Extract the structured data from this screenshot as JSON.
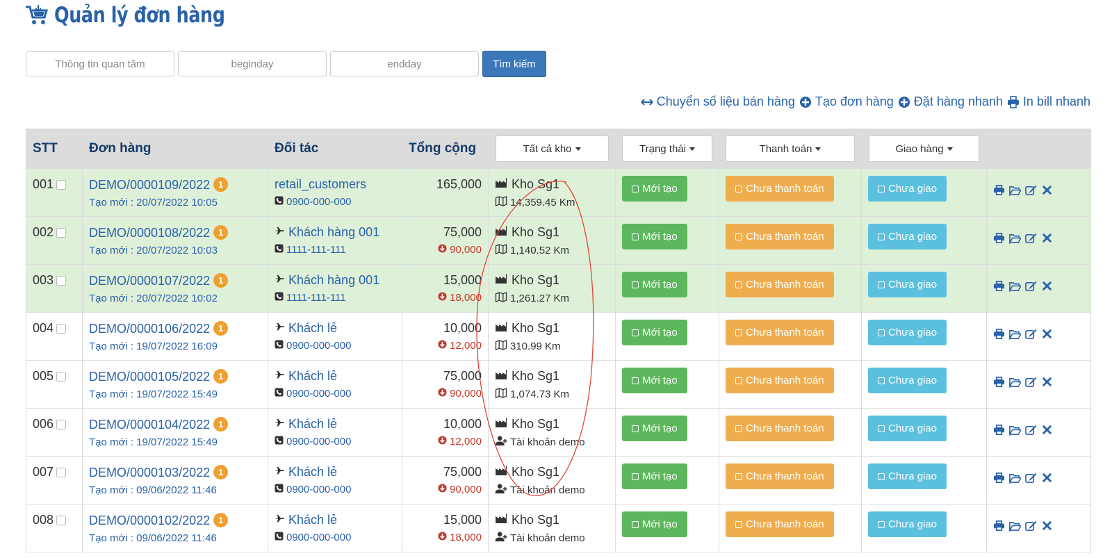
{
  "page": {
    "title": "Quản lý đơn hàng"
  },
  "search": {
    "interest_placeholder": "Thông tin quan tâm",
    "beginday_placeholder": "beginday",
    "endday_placeholder": "endday",
    "button_label": "Tìm kiếm"
  },
  "actions": {
    "transfer": "Chuyển số liệu bán hàng",
    "create_order": "Tạo đơn hàng",
    "quick_order": "Đặt hàng nhanh",
    "print_bill": "In bill nhanh"
  },
  "table": {
    "headers": {
      "stt": "STT",
      "order": "Đơn hàng",
      "partner": "Đối tác",
      "total": "Tổng cộng",
      "warehouse_filter": "Tất cả kho",
      "status_filter": "Trạng thái",
      "payment_filter": "Thanh toán",
      "delivery_filter": "Giao hàng"
    },
    "rows": [
      {
        "stt": "001",
        "order": "DEMO/0000109/2022",
        "badge": "1",
        "created": "Tạo mới : 20/07/2022 10:05",
        "partner": "retail_customers",
        "phone": "0900-000-000",
        "total": "165,000",
        "old_total": "",
        "warehouse": "Kho Sg1",
        "info": "14,359.45 Km",
        "info_type": "map",
        "status": "Mới tạo",
        "payment": "Chưa thanh toán",
        "delivery": "Chưa giao",
        "highlight": true,
        "partner_icon": false
      },
      {
        "stt": "002",
        "order": "DEMO/0000108/2022",
        "badge": "1",
        "created": "Tạo mới : 20/07/2022 10:03",
        "partner": "Khách hàng 001",
        "phone": "1111-111-111",
        "total": "75,000",
        "old_total": "90,000",
        "warehouse": "Kho Sg1",
        "info": "1,140.52 Km",
        "info_type": "map",
        "status": "Mới tạo",
        "payment": "Chưa thanh toán",
        "delivery": "Chưa giao",
        "highlight": true,
        "partner_icon": true
      },
      {
        "stt": "003",
        "order": "DEMO/0000107/2022",
        "badge": "1",
        "created": "Tạo mới : 20/07/2022 10:02",
        "partner": "Khách hàng 001",
        "phone": "1111-111-111",
        "total": "15,000",
        "old_total": "18,000",
        "warehouse": "Kho Sg1",
        "info": "1,261.27 Km",
        "info_type": "map",
        "status": "Mới tạo",
        "payment": "Chưa thanh toán",
        "delivery": "Chưa giao",
        "highlight": true,
        "partner_icon": true
      },
      {
        "stt": "004",
        "order": "DEMO/0000106/2022",
        "badge": "1",
        "created": "Tạo mới : 19/07/2022 16:09",
        "partner": "Khách lẻ",
        "phone": "0900-000-000",
        "total": "10,000",
        "old_total": "12,000",
        "warehouse": "Kho Sg1",
        "info": "310.99 Km",
        "info_type": "map",
        "status": "Mới tạo",
        "payment": "Chưa thanh toán",
        "delivery": "Chưa giao",
        "highlight": false,
        "partner_icon": true
      },
      {
        "stt": "005",
        "order": "DEMO/0000105/2022",
        "badge": "1",
        "created": "Tạo mới : 19/07/2022 15:49",
        "partner": "Khách lẻ",
        "phone": "0900-000-000",
        "total": "75,000",
        "old_total": "90,000",
        "warehouse": "Kho Sg1",
        "info": "1,074.73 Km",
        "info_type": "map",
        "status": "Mới tạo",
        "payment": "Chưa thanh toán",
        "delivery": "Chưa giao",
        "highlight": false,
        "partner_icon": true
      },
      {
        "stt": "006",
        "order": "DEMO/0000104/2022",
        "badge": "1",
        "created": "Tạo mới : 19/07/2022 15:49",
        "partner": "Khách lẻ",
        "phone": "0900-000-000",
        "total": "10,000",
        "old_total": "12,000",
        "warehouse": "Kho Sg1",
        "info": "Tài khoản demo",
        "info_type": "user",
        "status": "Mới tạo",
        "payment": "Chưa thanh toán",
        "delivery": "Chưa giao",
        "highlight": false,
        "partner_icon": true
      },
      {
        "stt": "007",
        "order": "DEMO/0000103/2022",
        "badge": "1",
        "created": "Tạo mới : 09/06/2022 11:46",
        "partner": "Khách lẻ",
        "phone": "0900-000-000",
        "total": "75,000",
        "old_total": "90,000",
        "warehouse": "Kho Sg1",
        "info": "Tài khoản demo",
        "info_type": "user",
        "status": "Mới tạo",
        "payment": "Chưa thanh toán",
        "delivery": "Chưa giao",
        "highlight": false,
        "partner_icon": true
      },
      {
        "stt": "008",
        "order": "DEMO/0000102/2022",
        "badge": "1",
        "created": "Tạo mới : 09/06/2022 11:46",
        "partner": "Khách lẻ",
        "phone": "0900-000-000",
        "total": "15,000",
        "old_total": "18,000",
        "warehouse": "Kho Sg1",
        "info": "Tài khoản demo",
        "info_type": "user",
        "status": "Mới tạo",
        "payment": "Chưa thanh toán",
        "delivery": "Chưa giao",
        "highlight": false,
        "partner_icon": true
      }
    ]
  },
  "colors": {
    "brand": "#2a62a8",
    "status_new": "#5cb85c",
    "payment_pending": "#f0ad4e",
    "delivery_pending": "#5bc0de",
    "row_highlight": "#dff0d8",
    "old_price": "#c0392b",
    "annotation": "#e0453a"
  },
  "icons": {
    "header": "cart-icon",
    "transfer": "arrows-horizontal-icon",
    "create": "plus-circle-icon",
    "print": "printer-icon",
    "warehouse": "factory-icon",
    "distance": "map-icon",
    "user": "user-plus-icon",
    "partner": "plane-icon",
    "phone": "phone-icon",
    "decrease": "arrow-circle-down-icon",
    "row_tools": [
      "printer-icon",
      "folder-open-icon",
      "edit-icon",
      "close-icon"
    ]
  }
}
